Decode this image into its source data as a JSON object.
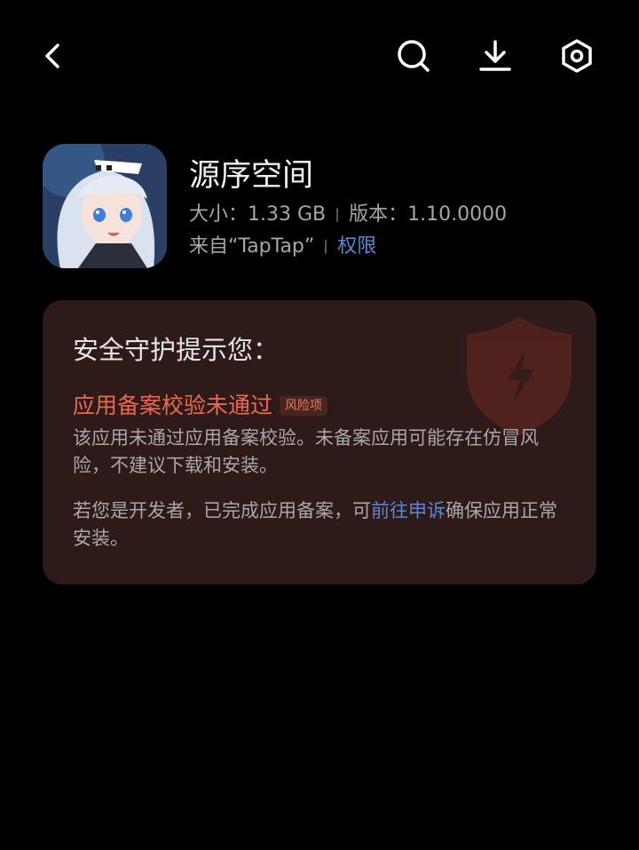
{
  "topbar": {
    "back_icon": "back-arrow-icon",
    "search_icon": "search-icon",
    "download_icon": "download-icon",
    "settings_icon": "settings-hex-icon"
  },
  "app": {
    "name": "源序空间",
    "size_label": "大小：",
    "size_value": "1.33 GB",
    "version_label": "版本：",
    "version_value": "1.10.0000",
    "source": "来自“TapTap”",
    "permissions_label": "权限"
  },
  "security": {
    "title": "安全守护提示您：",
    "risk_title": "应用备案校验未通过",
    "risk_badge": "风险项",
    "description": "该应用未通过应用备案校验。未备案应用可能存在仿冒风险，不建议下载和安装。",
    "dev_prefix": "若您是开发者，已完成应用备案，可",
    "dev_link": "前往申诉",
    "dev_suffix": "确保应用正常安装。"
  },
  "colors": {
    "background": "#000000",
    "card_bg": "#2e1a18",
    "risk_red": "#e96a50",
    "link_blue": "#5a86d8"
  }
}
